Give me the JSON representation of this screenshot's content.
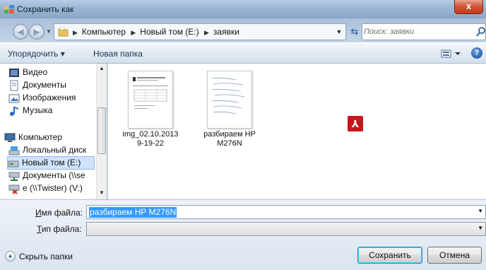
{
  "window": {
    "title": "Сохранить как",
    "close_glyph": "x"
  },
  "address": {
    "crumbs": [
      "Компьютер",
      "Новый том (E:)",
      "заявки"
    ],
    "search_placeholder": "Поиск: заявки"
  },
  "toolbar": {
    "organize_label": "Упорядочить ▾",
    "new_folder_label": "Новая папка",
    "help_glyph": "?"
  },
  "nav": {
    "items": [
      {
        "label": "Видео",
        "icon": "video-icon"
      },
      {
        "label": "Документы",
        "icon": "documents-icon"
      },
      {
        "label": "Изображения",
        "icon": "pictures-icon"
      },
      {
        "label": "Музыка",
        "icon": "music-icon"
      },
      {
        "label": "Компьютер",
        "icon": "computer-icon"
      },
      {
        "label": "Локальный диск",
        "icon": "drive-icon"
      },
      {
        "label": "Новый том (E:)",
        "icon": "drive-icon",
        "selected": true
      },
      {
        "label": "Документы (\\\\se",
        "icon": "network-drive-icon"
      },
      {
        "label": "e (\\\\Twister) (V:)",
        "icon": "disconnected-drive-icon"
      }
    ]
  },
  "files": [
    {
      "name_line1": "img_02.10.2013",
      "name_line2": "9-19-22",
      "icon": "image-file-icon"
    },
    {
      "name_line1": "разбираем HP",
      "name_line2": "M276N",
      "icon": "pdf-file-icon"
    }
  ],
  "form": {
    "filename_label_u": "И",
    "filename_label_rest": "мя файла:",
    "filename_value": "разбираем HP M276N",
    "filetype_label_u": "Т",
    "filetype_label_rest": "ип файла:",
    "filetype_value": ""
  },
  "footer": {
    "hide_folders_label": "Скрыть папки",
    "save_label": "Сохранить",
    "cancel_label": "Отмена"
  },
  "colors": {
    "selection": "#3399ff",
    "close_button": "#c6381c",
    "pdf_badge": "#c4161c"
  }
}
